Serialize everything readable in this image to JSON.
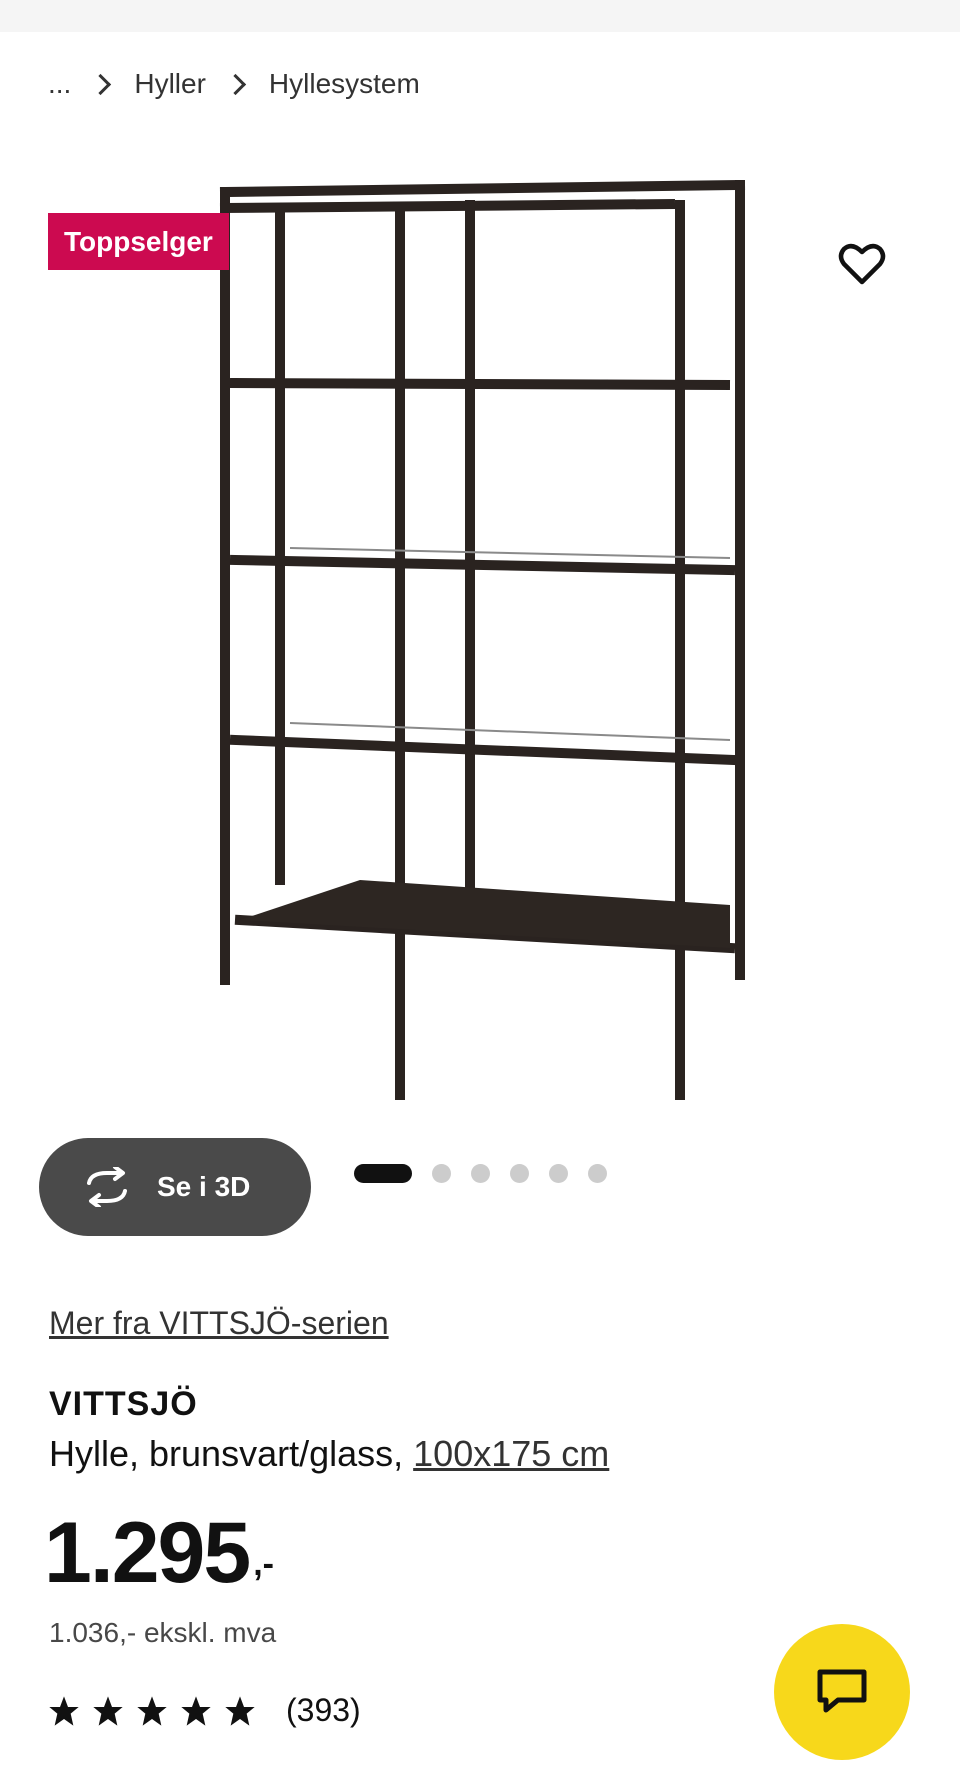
{
  "breadcrumb": {
    "ellipsis": "...",
    "items": [
      "Hyller",
      "Hyllesystem"
    ]
  },
  "badge": {
    "label": "Toppselger",
    "color": "#cc0a50"
  },
  "gallery": {
    "view_3d_label": "Se i 3D",
    "active_index": 1,
    "total_images": 6
  },
  "product": {
    "series_link": "Mer fra VITTSJÖ-serien",
    "name": "VITTSJÖ",
    "description": "Hylle, brunsvart/glass,",
    "measure": "100x175 cm",
    "price_main": "1.295",
    "price_suffix": ",-",
    "price_ex_vat": "1.036,- ekskl. mva",
    "rating_stars": 5,
    "review_count": "(393)"
  },
  "icons": {
    "favorite": "heart-icon",
    "view3d": "rotate-icon",
    "chat": "chat-icon"
  },
  "colors": {
    "chat_button": "#f7d81b",
    "view3d_button": "#4a4a4a"
  }
}
